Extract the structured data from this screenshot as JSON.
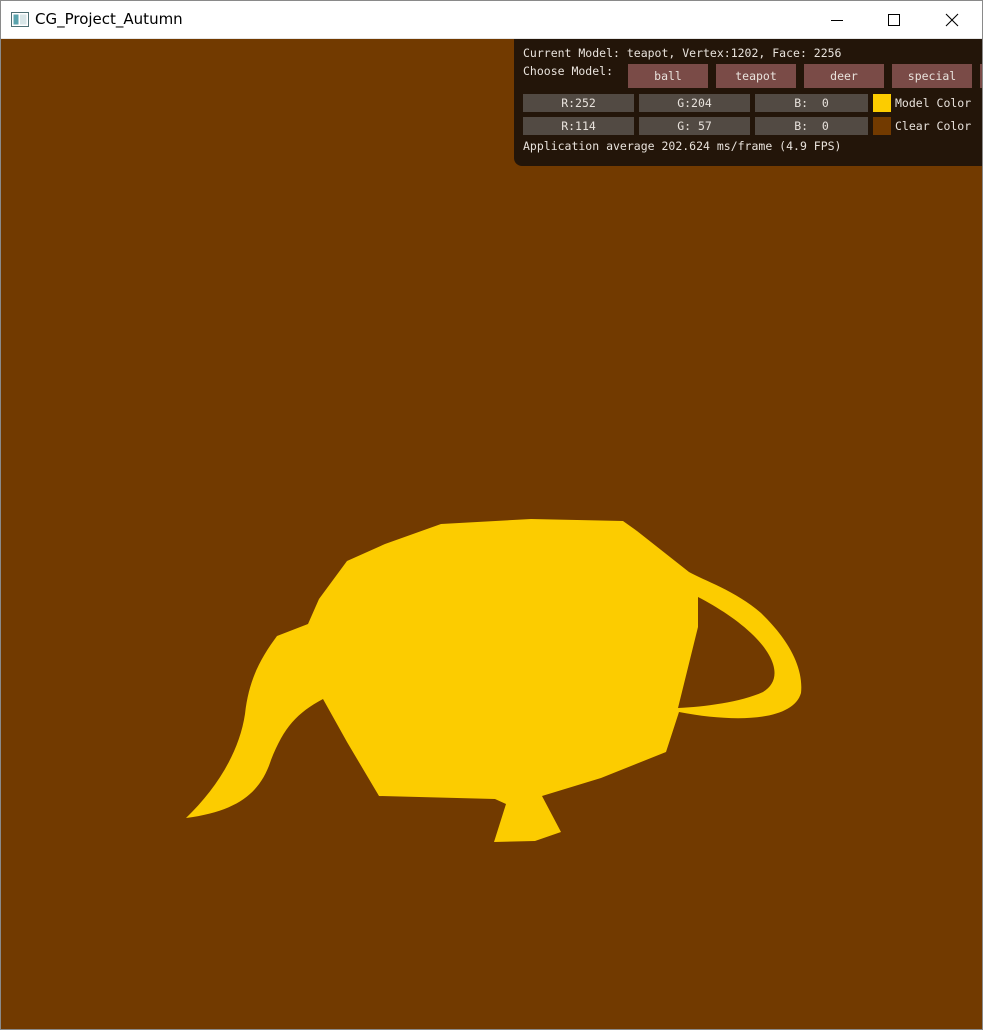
{
  "window": {
    "title": "CG_Project_Autumn",
    "controls": {
      "minimize": "minimize-icon",
      "maximize": "maximize-icon",
      "close": "close-icon"
    }
  },
  "colors": {
    "clear": "#723A00",
    "model": "#FCCC00",
    "panel_bg": "#231509",
    "button": "#7a4b47",
    "slider": "#524a43"
  },
  "panel": {
    "current_model_line": "Current Model: teapot, Vertex:1202, Face: 2256",
    "choose_label": "Choose Model:",
    "model_buttons": [
      "ball",
      "teapot",
      "deer",
      "special"
    ],
    "model_color": {
      "r": "R:252",
      "g": "G:204",
      "b": "B:  0",
      "label": "Model Color"
    },
    "clear_color": {
      "r": "R:114",
      "g": "G: 57",
      "b": "B:  0",
      "label": "Clear Color"
    },
    "fps_line": "Application average 202.624 ms/frame (4.9 FPS)"
  }
}
